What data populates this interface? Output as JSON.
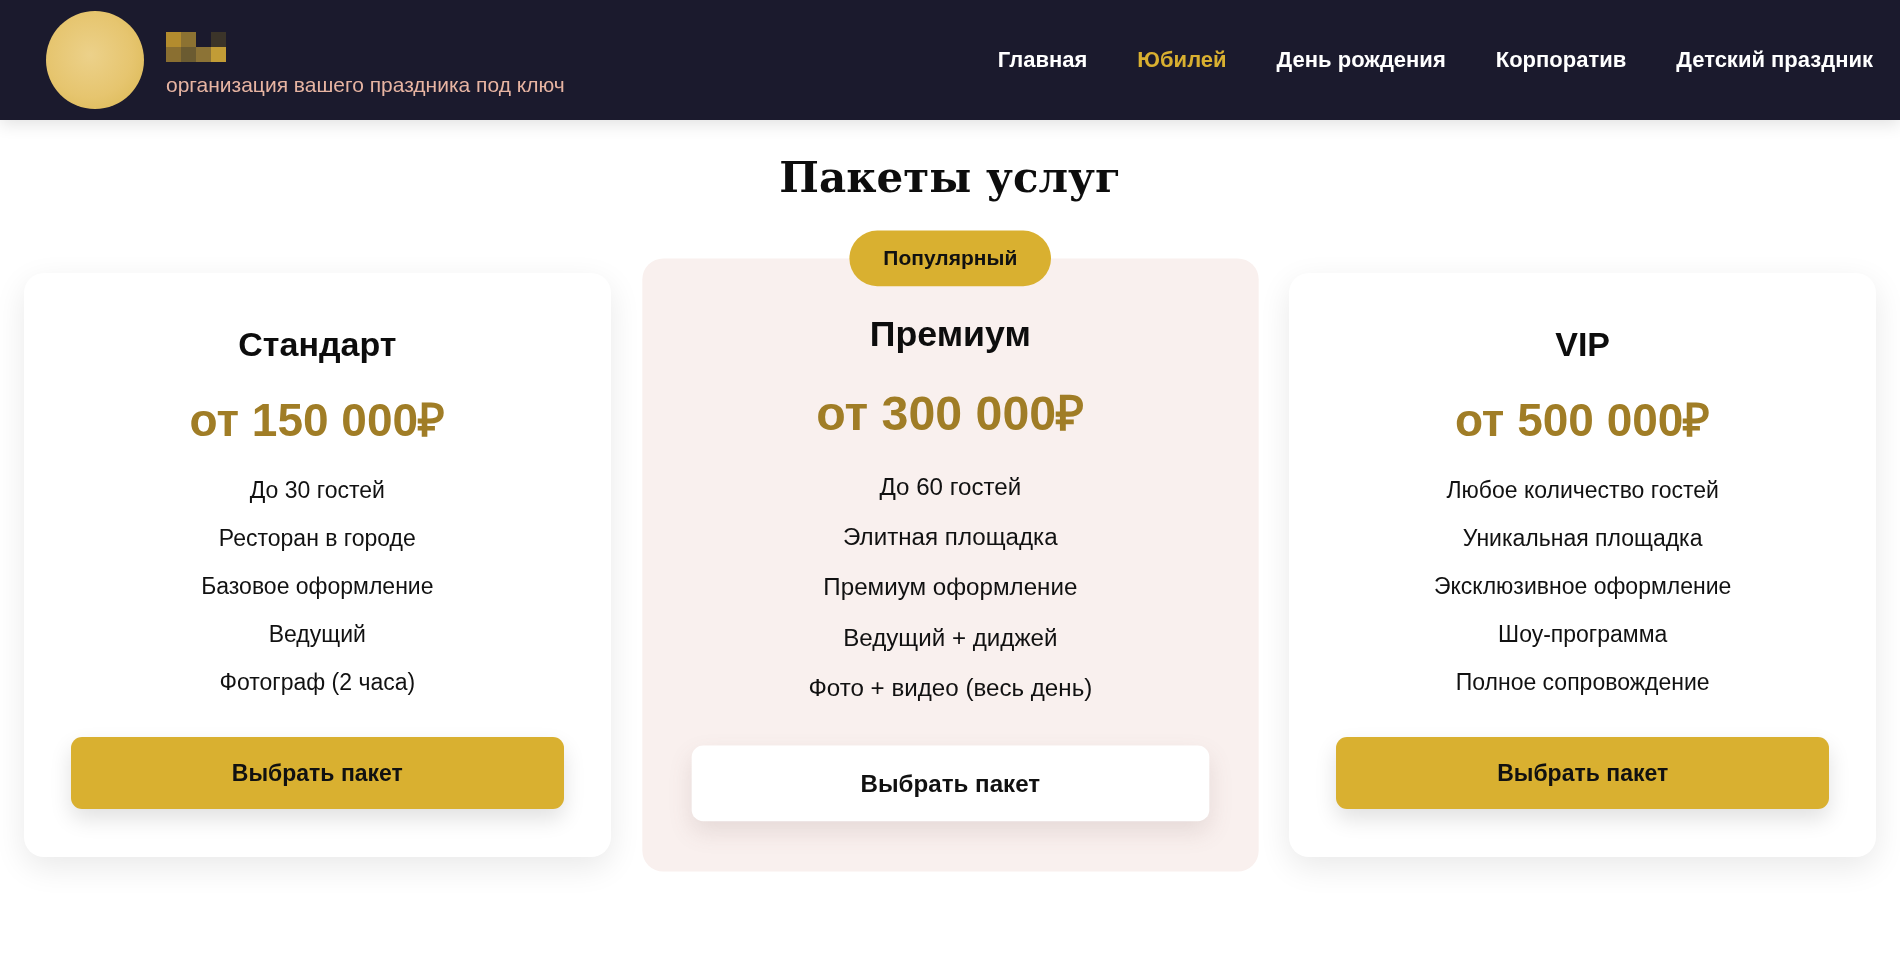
{
  "header": {
    "tagline": "организация вашего праздника под ключ",
    "nav": [
      {
        "label": "Главная",
        "selected": false
      },
      {
        "label": "Юбилей",
        "selected": true
      },
      {
        "label": "День рождения",
        "selected": false
      },
      {
        "label": "Корпоратив",
        "selected": false
      },
      {
        "label": "Детский праздник",
        "selected": false
      }
    ]
  },
  "section": {
    "title": "Пакеты услуг"
  },
  "packages": [
    {
      "name": "Стандарт",
      "price": "от 150 000₽",
      "features": [
        "До 30 гостей",
        "Ресторан в городе",
        "Базовое оформление",
        "Ведущий",
        "Фотограф (2 часа)"
      ],
      "button": "Выбрать пакет",
      "featured": false
    },
    {
      "name": "Премиум",
      "badge": "Популярный",
      "price": "от 300 000₽",
      "features": [
        "До 60 гостей",
        "Элитная площадка",
        "Премиум оформление",
        "Ведущий + диджей",
        "Фото + видео (весь день)"
      ],
      "button": "Выбрать пакет",
      "featured": true
    },
    {
      "name": "VIP",
      "price": "от 500 000₽",
      "features": [
        "Любое количество гостей",
        "Уникальная площадка",
        "Эксклюзивное оформление",
        "Шоу-программа",
        "Полное сопровождение"
      ],
      "button": "Выбрать пакет",
      "featured": false
    }
  ]
}
